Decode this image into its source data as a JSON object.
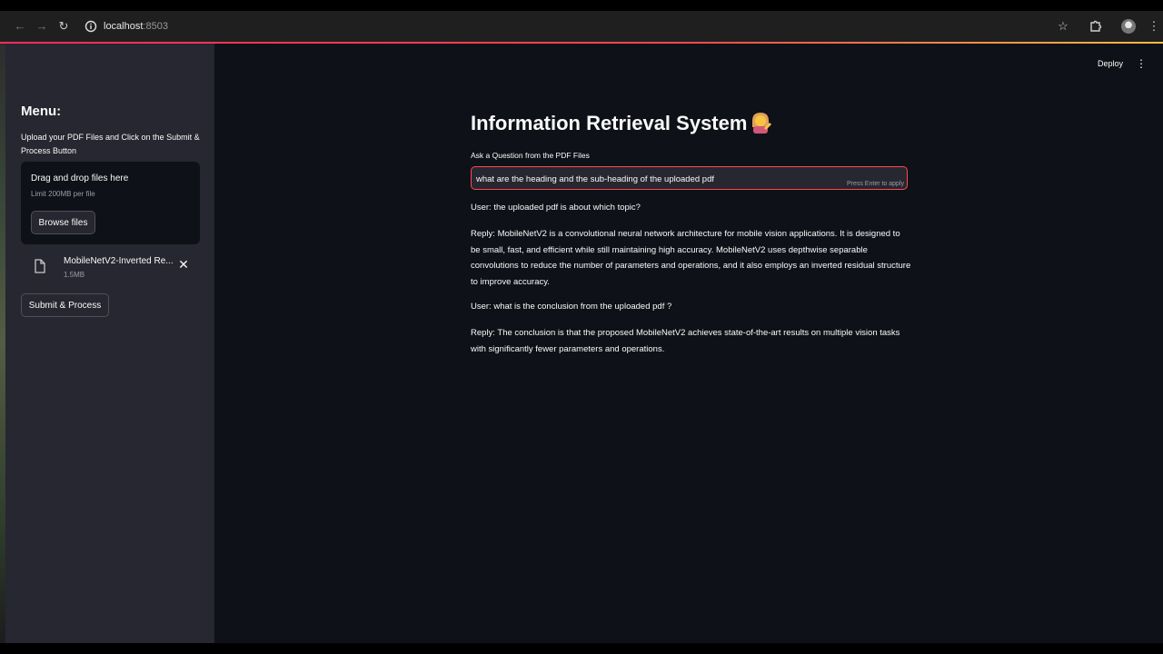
{
  "browser": {
    "url_host": "localhost",
    "url_port": ":8503"
  },
  "sidebar": {
    "menu_title": "Menu:",
    "upload_help": "Upload your PDF Files and Click on the Submit & Process Button",
    "dropzone": {
      "title": "Drag and drop files here",
      "limit": "Limit 200MB per file",
      "browse_label": "Browse files"
    },
    "uploaded_file": {
      "name": "MobileNetV2-Inverted Re...",
      "size": "1.5MB"
    },
    "submit_label": "Submit & Process"
  },
  "header": {
    "deploy_label": "Deploy"
  },
  "main": {
    "title": "Information Retrieval System",
    "title_emoji": "woman-tipping-hand",
    "question_label": "Ask a Question from the PDF Files",
    "question_value": "what are the heading and the sub-heading of the uploaded pdf",
    "enter_hint": "Press Enter to apply",
    "chat": [
      "User: the uploaded pdf is about which topic?",
      "Reply: MobileNetV2 is a convolutional neural network architecture for mobile vision applications. It is designed to be small, fast, and efficient while still maintaining high accuracy. MobileNetV2 uses depthwise separable convolutions to reduce the number of parameters and operations, and it also employs an inverted residual structure to improve accuracy.",
      "User: what is the conclusion from the uploaded pdf ?",
      "Reply: The conclusion is that the proposed MobileNetV2 achieves state-of-the-art results on multiple vision tasks with significantly fewer parameters and operations."
    ]
  },
  "colors": {
    "sidebar_bg": "#262730",
    "main_bg": "#0e1117",
    "accent": "#ff4b4b",
    "text": "#fafafa"
  }
}
